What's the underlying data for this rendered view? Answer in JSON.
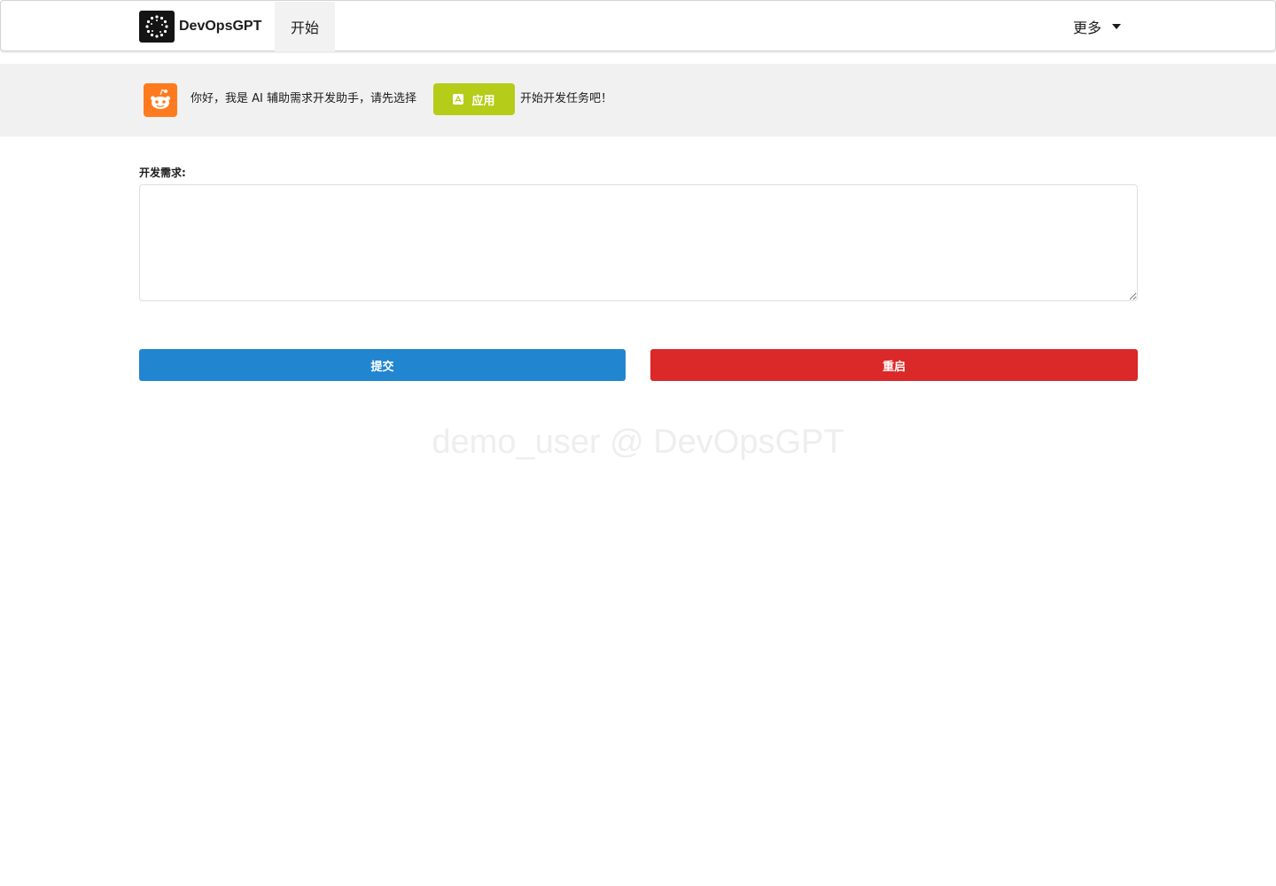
{
  "menubar": {
    "brand_name": "DevOpsGPT",
    "start_label": "开始",
    "more_label": "更多"
  },
  "greeting": {
    "text_before": "你好，我是 AI 辅助需求开发助手，请先选择",
    "app_button_label": "应用",
    "text_after": "开始开发任务吧！"
  },
  "form": {
    "requirement_label": "开发需求:",
    "requirement_value": "",
    "submit_label": "提交",
    "reset_label": "重启"
  },
  "watermark": "demo_user @ DevOpsGPT",
  "colors": {
    "submit": "#2185d0",
    "reset": "#db2828",
    "app_button": "#b5cc18",
    "avatar": "#ff7a1e"
  }
}
